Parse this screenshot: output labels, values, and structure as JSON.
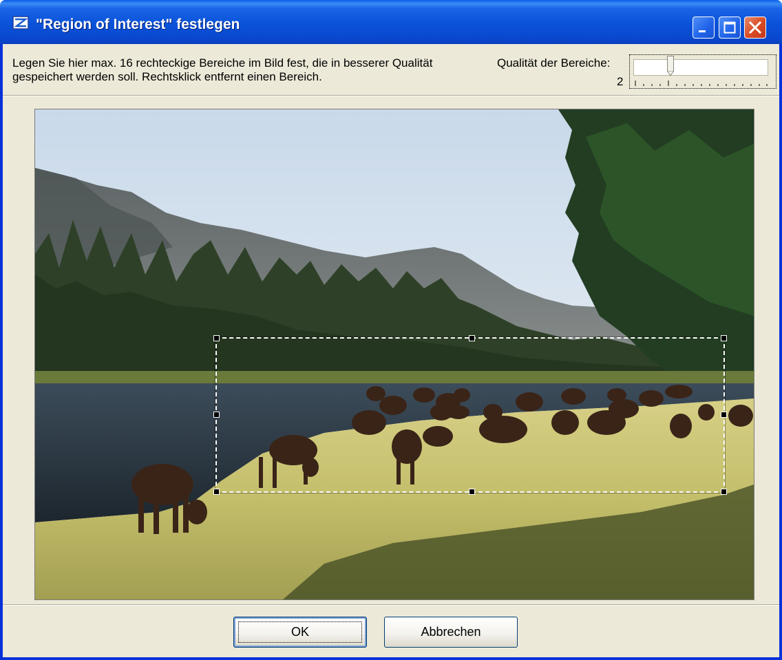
{
  "window": {
    "title": "\"Region of Interest\" festlegen",
    "icon": "app-icon",
    "controls": [
      "minimize-icon",
      "maximize-icon",
      "close-icon"
    ]
  },
  "header": {
    "description": "Legen Sie hier max. 16 rechteckige Bereiche im Bild fest, die in besserer Qualität gespeichert werden soll. Rechtsklick entfernt einen Bereich.",
    "quality_label": "Qualität der Bereiche:",
    "quality_value": "2"
  },
  "colors": {
    "titlebar": "#0a52d9",
    "window_bg": "#ece9d8",
    "close_button": "#d94a24"
  },
  "buttons": {
    "ok": "OK",
    "cancel": "Abbrechen"
  }
}
